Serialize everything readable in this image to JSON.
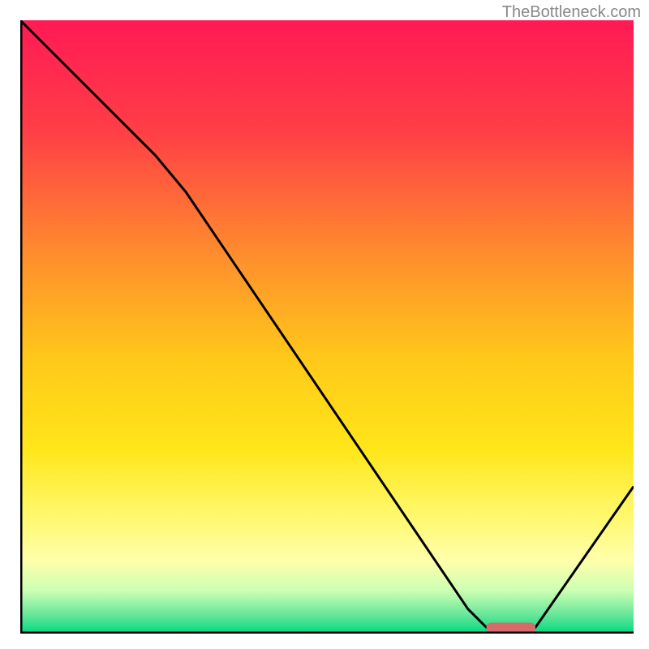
{
  "watermark": "TheBottleneck.com",
  "chart_data": {
    "type": "line",
    "title": "",
    "xlabel": "",
    "ylabel": "",
    "xlim": [
      0,
      100
    ],
    "ylim": [
      0,
      100
    ],
    "gradient_stops": [
      {
        "offset": 0,
        "color": "#ff1a55"
      },
      {
        "offset": 18,
        "color": "#ff3e46"
      },
      {
        "offset": 38,
        "color": "#ff8c2e"
      },
      {
        "offset": 55,
        "color": "#ffc81a"
      },
      {
        "offset": 70,
        "color": "#ffe61a"
      },
      {
        "offset": 80,
        "color": "#fff766"
      },
      {
        "offset": 88,
        "color": "#ffffaa"
      },
      {
        "offset": 93,
        "color": "#ccffb3"
      },
      {
        "offset": 97,
        "color": "#66e699"
      },
      {
        "offset": 100,
        "color": "#00d980"
      }
    ],
    "line_points": [
      {
        "x": 0,
        "y": 100
      },
      {
        "x": 22,
        "y": 78
      },
      {
        "x": 27,
        "y": 72
      },
      {
        "x": 73,
        "y": 4
      },
      {
        "x": 76,
        "y": 1
      },
      {
        "x": 84,
        "y": 1
      },
      {
        "x": 100,
        "y": 24
      }
    ],
    "marker": {
      "x_start": 76,
      "x_end": 84,
      "y": 1,
      "color": "#d96a6a"
    },
    "axes_color": "#000000",
    "axes_width": 5
  }
}
